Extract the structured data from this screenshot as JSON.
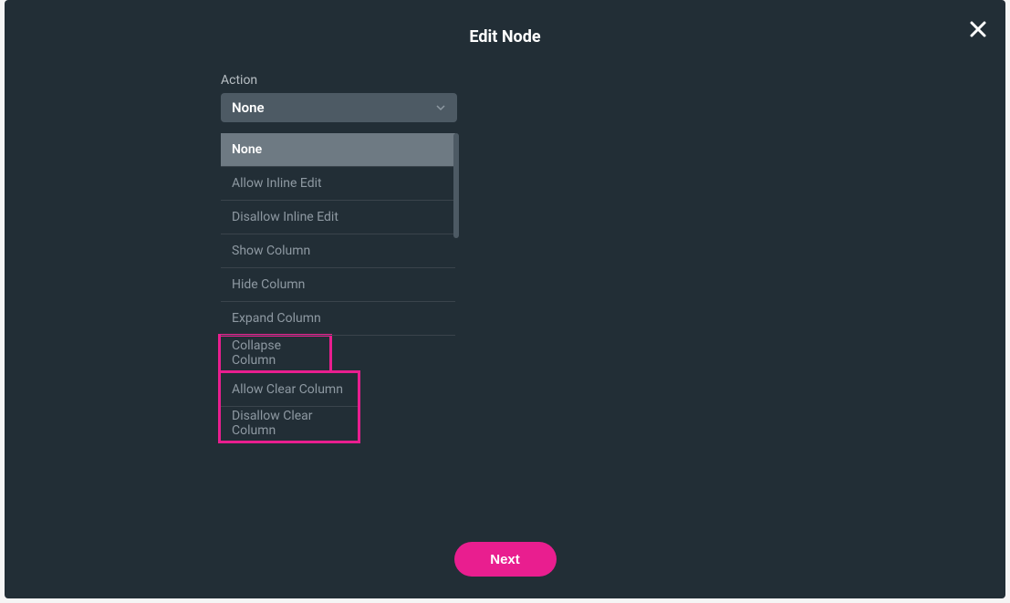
{
  "modal": {
    "title": "Edit Node"
  },
  "action": {
    "label": "Action",
    "selected": "None",
    "options": [
      "None",
      "Allow Inline Edit",
      "Disallow Inline Edit",
      "Show Column",
      "Hide Column",
      "Expand Column",
      "Collapse Column",
      "Allow Clear Column",
      "Disallow Clear Column"
    ]
  },
  "footer": {
    "next_label": "Next"
  }
}
